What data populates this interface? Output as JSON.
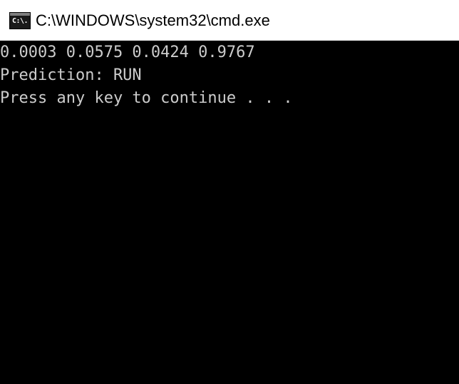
{
  "window": {
    "title": "C:\\WINDOWS\\system32\\cmd.exe",
    "icon": "cmd-icon",
    "icon_text": "C:\\."
  },
  "console": {
    "lines": [
      "0.0003 0.0575 0.0424 0.9767",
      "Prediction: RUN",
      "Press any key to continue . . ."
    ],
    "text_color": "#cccccc",
    "background_color": "#000000"
  }
}
